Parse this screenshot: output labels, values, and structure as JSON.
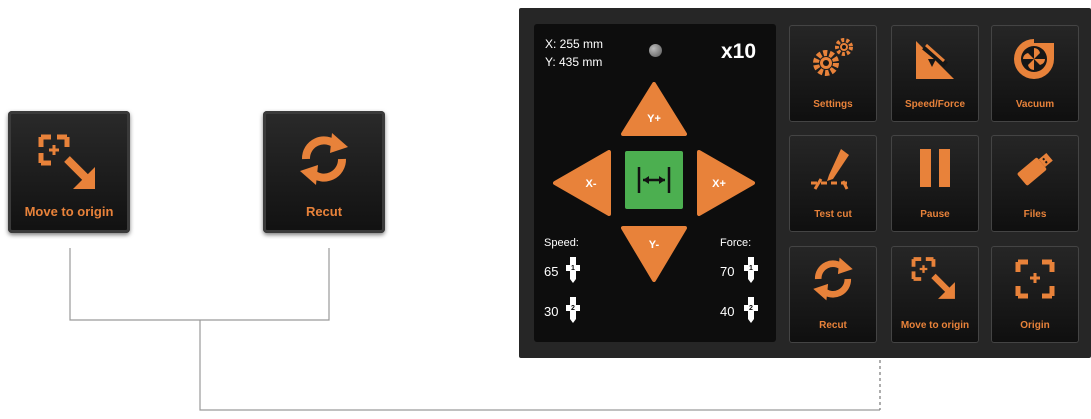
{
  "callouts": {
    "move_to_origin": "Move to origin",
    "recut": "Recut"
  },
  "panel": {
    "coord_x": "X: 255 mm",
    "coord_y": "Y: 435 mm",
    "multiplier": "x10",
    "jog": {
      "up": "Y+",
      "down": "Y-",
      "left": "X-",
      "right": "X+",
      "center_icon": "horizontal-expand-icon"
    },
    "speed": {
      "label": "Speed:",
      "tool1": "65",
      "tool2": "30"
    },
    "force": {
      "label": "Force:",
      "tool1": "70",
      "tool2": "40"
    },
    "tiles": {
      "settings": "Settings",
      "speed_force": "Speed/Force",
      "vacuum": "Vacuum",
      "test_cut": "Test cut",
      "pause": "Pause",
      "files": "Files",
      "recut": "Recut",
      "move_to_origin": "Move to origin",
      "origin": "Origin"
    }
  },
  "colors": {
    "accent": "#e8823a",
    "center_button": "#4caf50",
    "panel_bg": "#262626"
  }
}
